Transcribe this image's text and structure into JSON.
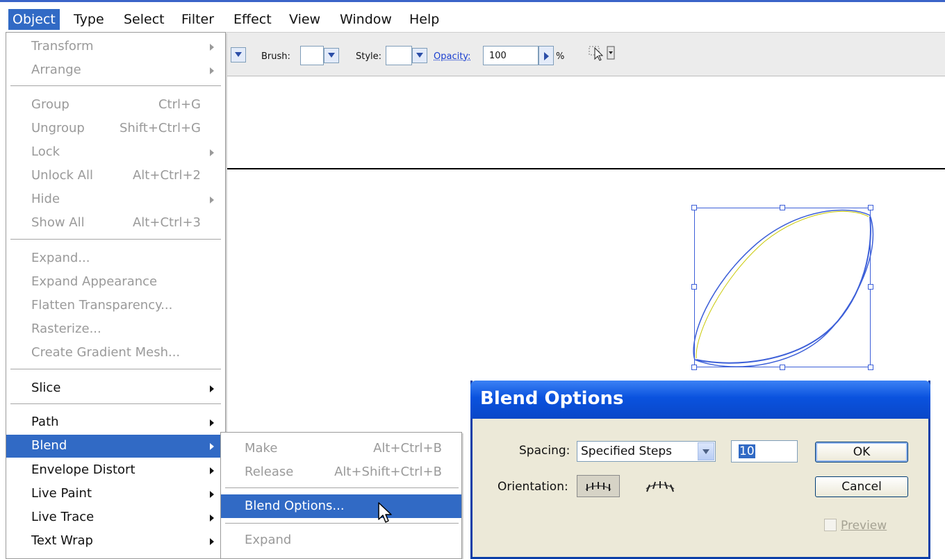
{
  "menubar": {
    "items": [
      "Object",
      "Type",
      "Select",
      "Filter",
      "Effect",
      "View",
      "Window",
      "Help"
    ]
  },
  "controlbar": {
    "brush_label": "Brush:",
    "style_label": "Style:",
    "opacity_label": "Opacity:",
    "opacity_value": "100",
    "opacity_unit": "%"
  },
  "object_menu": {
    "items": [
      {
        "label": "Transform",
        "shortcut": "",
        "submenu": true,
        "enabled": false
      },
      {
        "label": "Arrange",
        "shortcut": "",
        "submenu": true,
        "enabled": false
      },
      {
        "label": "Group",
        "shortcut": "Ctrl+G",
        "submenu": false,
        "enabled": false
      },
      {
        "label": "Ungroup",
        "shortcut": "Shift+Ctrl+G",
        "submenu": false,
        "enabled": false
      },
      {
        "label": "Lock",
        "shortcut": "",
        "submenu": true,
        "enabled": false
      },
      {
        "label": "Unlock All",
        "shortcut": "Alt+Ctrl+2",
        "submenu": false,
        "enabled": false
      },
      {
        "label": "Hide",
        "shortcut": "",
        "submenu": true,
        "enabled": false
      },
      {
        "label": "Show All",
        "shortcut": "Alt+Ctrl+3",
        "submenu": false,
        "enabled": false
      },
      {
        "label": "Expand...",
        "shortcut": "",
        "submenu": false,
        "enabled": false
      },
      {
        "label": "Expand Appearance",
        "shortcut": "",
        "submenu": false,
        "enabled": false
      },
      {
        "label": "Flatten Transparency...",
        "shortcut": "",
        "submenu": false,
        "enabled": false
      },
      {
        "label": "Rasterize...",
        "shortcut": "",
        "submenu": false,
        "enabled": false
      },
      {
        "label": "Create Gradient Mesh...",
        "shortcut": "",
        "submenu": false,
        "enabled": false
      },
      {
        "label": "Slice",
        "shortcut": "",
        "submenu": true,
        "enabled": true
      },
      {
        "label": "Path",
        "shortcut": "",
        "submenu": true,
        "enabled": true
      },
      {
        "label": "Blend",
        "shortcut": "",
        "submenu": true,
        "enabled": true,
        "highlighted": true
      },
      {
        "label": "Envelope Distort",
        "shortcut": "",
        "submenu": true,
        "enabled": true
      },
      {
        "label": "Live Paint",
        "shortcut": "",
        "submenu": true,
        "enabled": true
      },
      {
        "label": "Live Trace",
        "shortcut": "",
        "submenu": true,
        "enabled": true
      },
      {
        "label": "Text Wrap",
        "shortcut": "",
        "submenu": true,
        "enabled": true
      }
    ]
  },
  "blend_submenu": {
    "items": [
      {
        "label": "Make",
        "shortcut": "Alt+Ctrl+B",
        "enabled": false
      },
      {
        "label": "Release",
        "shortcut": "Alt+Shift+Ctrl+B",
        "enabled": false
      },
      {
        "label": "Blend Options...",
        "shortcut": "",
        "enabled": true,
        "highlighted": true
      },
      {
        "label": "Expand",
        "shortcut": "",
        "enabled": false
      }
    ]
  },
  "dialog": {
    "title": "Blend Options",
    "spacing_label": "Spacing:",
    "spacing_value": "Specified Steps",
    "steps_value": "10",
    "orientation_label": "Orientation:",
    "ok_label": "OK",
    "cancel_label": "Cancel",
    "preview_label": "Preview",
    "preview_checked": false
  },
  "colors": {
    "menu_highlight": "#316ac5",
    "dialog_title": "#0a52de",
    "selection": "#3c5fd8"
  }
}
